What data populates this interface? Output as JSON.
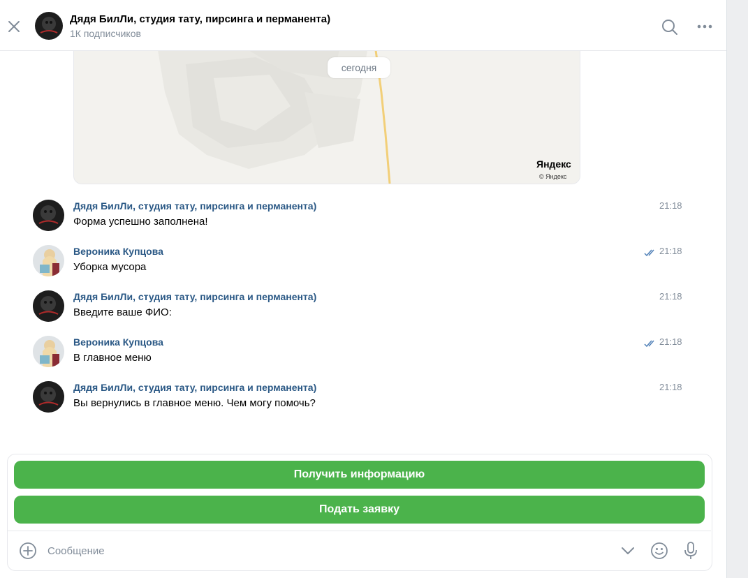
{
  "header": {
    "title": "Дядя БилЛи, студия тату, пирсинга и перманента)",
    "subtitle": "1К подписчиков"
  },
  "map": {
    "date_chip": "сегодня",
    "brand": "Яндекс",
    "copyright": "© Яндекс"
  },
  "messages": [
    {
      "author": "Дядя БилЛи, студия тату, пирсинга и перманента)",
      "text": "Форма успешно заполнена!",
      "time": "21:18",
      "read": false,
      "avatar": "studio"
    },
    {
      "author": "Вероника Купцова",
      "text": "Уборка мусора",
      "time": "21:18",
      "read": true,
      "avatar": "user"
    },
    {
      "author": "Дядя БилЛи, студия тату, пирсинга и перманента)",
      "text": "Введите ваше ФИО:",
      "time": "21:18",
      "read": false,
      "avatar": "studio"
    },
    {
      "author": "Вероника Купцова",
      "text": "В главное меню",
      "time": "21:18",
      "read": true,
      "avatar": "user"
    },
    {
      "author": "Дядя БилЛи, студия тату, пирсинга и перманента)",
      "text": "Вы вернулись в главное меню. Чем могу помочь?",
      "time": "21:18",
      "read": false,
      "avatar": "studio"
    }
  ],
  "keyboard": {
    "buttons": [
      "Получить информацию",
      "Подать заявку"
    ],
    "color": "#4bb34b"
  },
  "composer": {
    "placeholder": "Сообщение"
  },
  "icons": {
    "close": "close-icon",
    "search": "search-icon",
    "more": "more-icon",
    "attach": "plus-circle-icon",
    "keyboard_toggle": "chevron-down-icon",
    "emoji": "smile-icon",
    "voice": "microphone-icon"
  },
  "colors": {
    "link": "#2a5885",
    "secondary": "#818c99",
    "read_ticks": "#5181b8"
  }
}
